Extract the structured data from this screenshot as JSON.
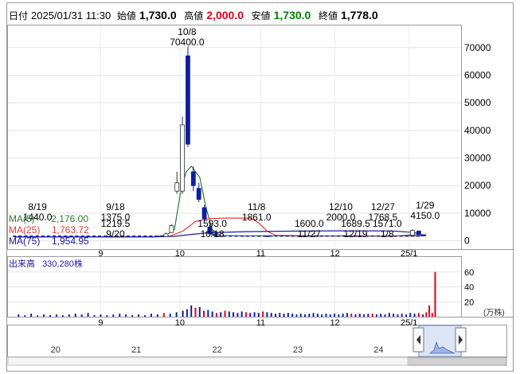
{
  "header": {
    "date_label": "日付",
    "date_value": "2025/01/31 11:30",
    "open_label": "始値",
    "open_value": "1,730.0",
    "high_label": "高値",
    "high_value": "2,000.0",
    "low_label": "安値",
    "low_value": "1,730.0",
    "close_label": "終値",
    "close_value": "1,778.0"
  },
  "colors": {
    "high": "#e0001b",
    "low": "#008000",
    "ma5": "#2e7d32",
    "ma25": "#e53935",
    "ma75": "#1a1aa6",
    "candle_up": "#ffffff",
    "candle_down": "#0d1f9e",
    "volume_up": "#e0001b",
    "volume_down": "#0d1f9e"
  },
  "legend": {
    "ma5": "MA(5)",
    "ma5_value": "2,176.00",
    "ma25": "MA(25)",
    "ma25_value": "1,763.72",
    "ma75": "MA(75)",
    "ma75_value": "1,954.95"
  },
  "volume_panel": {
    "title": "出来高",
    "value": "330,280株",
    "unit_label": "(万株)"
  },
  "chart_data": [
    {
      "type": "candlestick",
      "y_axis_side": "right",
      "ylim": [
        -3000,
        78000
      ],
      "y_ticks": [
        0,
        10000,
        20000,
        30000,
        40000,
        50000,
        60000,
        70000
      ],
      "x_ticks": [
        {
          "label": "9",
          "pos": 0.205
        },
        {
          "label": "10",
          "pos": 0.393
        },
        {
          "label": "11",
          "pos": 0.585
        },
        {
          "label": "12",
          "pos": 0.761
        },
        {
          "label": "25/1",
          "pos": 0.937
        }
      ],
      "annotations": [
        {
          "date": "8/19",
          "value": "1440.0",
          "kind": "high"
        },
        {
          "date": "9/18",
          "value": "1375.0",
          "kind": "high"
        },
        {
          "date": "9/20",
          "value": "1219.5",
          "kind": "low"
        },
        {
          "date": "10/8",
          "value": "70400.0",
          "kind": "high"
        },
        {
          "date": "10/18",
          "value": "1593.0",
          "kind": "low"
        },
        {
          "date": "11/8",
          "value": "1861.0",
          "kind": "high"
        },
        {
          "date": "11/27",
          "value": "1600.0",
          "kind": "low"
        },
        {
          "date": "12/10",
          "value": "2000.0",
          "kind": "high"
        },
        {
          "date": "12/19",
          "value": "1689.5",
          "kind": "low"
        },
        {
          "date": "12/27",
          "value": "1768.5",
          "kind": "high"
        },
        {
          "date": "1/8",
          "value": "1571.0",
          "kind": "low"
        },
        {
          "date": "1/29",
          "value": "4150.0",
          "kind": "high"
        }
      ],
      "candles": [
        {
          "pos": 0.36,
          "open": 1500,
          "close": 2500,
          "high": 3000,
          "low": 1400
        },
        {
          "pos": 0.373,
          "open": 3000,
          "close": 5500,
          "high": 6000,
          "low": 2800
        },
        {
          "pos": 0.386,
          "open": 18000,
          "close": 21000,
          "high": 25000,
          "low": 17000
        },
        {
          "pos": 0.399,
          "open": 18000,
          "close": 42000,
          "high": 45000,
          "low": 17000
        },
        {
          "pos": 0.412,
          "open": 67000,
          "close": 35000,
          "high": 70400,
          "low": 34000
        },
        {
          "pos": 0.425,
          "open": 25000,
          "close": 20000,
          "high": 27000,
          "low": 18000
        },
        {
          "pos": 0.438,
          "open": 19000,
          "close": 15000,
          "high": 21000,
          "low": 14000
        },
        {
          "pos": 0.451,
          "open": 12000,
          "close": 8000,
          "high": 13000,
          "low": 7000
        },
        {
          "pos": 0.464,
          "open": 5000,
          "close": 2500,
          "high": 6000,
          "low": 2000
        },
        {
          "pos": 0.477,
          "open": 2500,
          "close": 1800,
          "high": 3000,
          "low": 1593
        },
        {
          "pos": 0.6,
          "open": 1800,
          "close": 1700,
          "high": 1861,
          "low": 1650
        },
        {
          "pos": 0.785,
          "open": 1800,
          "close": 1900,
          "high": 2000,
          "low": 1700
        },
        {
          "pos": 0.945,
          "open": 2000,
          "close": 3800,
          "high": 4150,
          "low": 1900
        },
        {
          "pos": 0.96,
          "open": 3500,
          "close": 2200,
          "high": 3800,
          "low": 2000
        },
        {
          "pos": 0.972,
          "open": 2200,
          "close": 1778,
          "high": 2300,
          "low": 1730
        }
      ],
      "ma_series": [
        {
          "name": "MA(5)",
          "color_key": "ma5",
          "points": [
            [
              0.0,
              1400
            ],
            [
              0.33,
              1450
            ],
            [
              0.36,
              2000
            ],
            [
              0.38,
              4000
            ],
            [
              0.395,
              18000
            ],
            [
              0.408,
              25000
            ],
            [
              0.42,
              27000
            ],
            [
              0.44,
              23000
            ],
            [
              0.455,
              12000
            ],
            [
              0.47,
              4000
            ],
            [
              0.49,
              1900
            ],
            [
              0.55,
              1750
            ],
            [
              0.6,
              1780
            ],
            [
              0.7,
              1700
            ],
            [
              0.8,
              1750
            ],
            [
              0.9,
              1650
            ],
            [
              0.945,
              2200
            ],
            [
              0.97,
              2176
            ]
          ]
        },
        {
          "name": "MA(25)",
          "color_key": "ma25",
          "points": [
            [
              0.0,
              1450
            ],
            [
              0.33,
              1420
            ],
            [
              0.37,
              1700
            ],
            [
              0.4,
              3500
            ],
            [
              0.43,
              7000
            ],
            [
              0.46,
              8000
            ],
            [
              0.5,
              8200
            ],
            [
              0.56,
              8200
            ],
            [
              0.58,
              6500
            ],
            [
              0.6,
              3500
            ],
            [
              0.62,
              2000
            ],
            [
              0.7,
              1800
            ],
            [
              0.85,
              1760
            ],
            [
              0.97,
              1764
            ]
          ]
        },
        {
          "name": "MA(75)",
          "color_key": "ma75",
          "points": [
            [
              0.0,
              1400
            ],
            [
              0.33,
              1410
            ],
            [
              0.38,
              1600
            ],
            [
              0.42,
              2300
            ],
            [
              0.46,
              2900
            ],
            [
              0.55,
              3300
            ],
            [
              0.65,
              3500
            ],
            [
              0.75,
              3600
            ],
            [
              0.85,
              3600
            ],
            [
              0.9,
              3550
            ],
            [
              0.95,
              3000
            ],
            [
              0.97,
              1955
            ]
          ]
        }
      ]
    },
    {
      "type": "bar",
      "title": "出来高",
      "unit": "万株",
      "ylim": [
        0,
        80
      ],
      "y_ticks": [
        20,
        40,
        60
      ],
      "x_ticks": [
        {
          "label": "9",
          "pos": 0.205
        },
        {
          "label": "10",
          "pos": 0.393
        },
        {
          "label": "11",
          "pos": 0.585
        },
        {
          "label": "12",
          "pos": 0.761
        },
        {
          "label": "25/1",
          "pos": 0.937
        }
      ],
      "bars": [
        {
          "pos": 0.01,
          "v": 3,
          "up": false
        },
        {
          "pos": 0.025,
          "v": 2,
          "up": false
        },
        {
          "pos": 0.04,
          "v": 4,
          "up": false
        },
        {
          "pos": 0.055,
          "v": 2,
          "up": true
        },
        {
          "pos": 0.07,
          "v": 3,
          "up": false
        },
        {
          "pos": 0.085,
          "v": 2,
          "up": false
        },
        {
          "pos": 0.1,
          "v": 3,
          "up": false
        },
        {
          "pos": 0.115,
          "v": 2,
          "up": false
        },
        {
          "pos": 0.13,
          "v": 3,
          "up": false
        },
        {
          "pos": 0.145,
          "v": 4,
          "up": false
        },
        {
          "pos": 0.16,
          "v": 3,
          "up": false
        },
        {
          "pos": 0.175,
          "v": 5,
          "up": false
        },
        {
          "pos": 0.19,
          "v": 2,
          "up": false
        },
        {
          "pos": 0.205,
          "v": 3,
          "up": false
        },
        {
          "pos": 0.22,
          "v": 2,
          "up": false
        },
        {
          "pos": 0.235,
          "v": 3,
          "up": false
        },
        {
          "pos": 0.25,
          "v": 4,
          "up": false
        },
        {
          "pos": 0.265,
          "v": 3,
          "up": false
        },
        {
          "pos": 0.28,
          "v": 2,
          "up": false
        },
        {
          "pos": 0.295,
          "v": 3,
          "up": false
        },
        {
          "pos": 0.31,
          "v": 2,
          "up": false
        },
        {
          "pos": 0.325,
          "v": 4,
          "up": false
        },
        {
          "pos": 0.34,
          "v": 3,
          "up": false
        },
        {
          "pos": 0.355,
          "v": 5,
          "up": true
        },
        {
          "pos": 0.37,
          "v": 4,
          "up": false
        },
        {
          "pos": 0.385,
          "v": 6,
          "up": false
        },
        {
          "pos": 0.4,
          "v": 8,
          "up": false
        },
        {
          "pos": 0.41,
          "v": 10,
          "up": false
        },
        {
          "pos": 0.42,
          "v": 15,
          "up": false
        },
        {
          "pos": 0.43,
          "v": 12,
          "up": true
        },
        {
          "pos": 0.44,
          "v": 13,
          "up": false
        },
        {
          "pos": 0.45,
          "v": 8,
          "up": true
        },
        {
          "pos": 0.46,
          "v": 9,
          "up": false
        },
        {
          "pos": 0.47,
          "v": 7,
          "up": false
        },
        {
          "pos": 0.48,
          "v": 5,
          "up": true
        },
        {
          "pos": 0.49,
          "v": 6,
          "up": false
        },
        {
          "pos": 0.5,
          "v": 8,
          "up": true
        },
        {
          "pos": 0.51,
          "v": 7,
          "up": false
        },
        {
          "pos": 0.52,
          "v": 6,
          "up": false
        },
        {
          "pos": 0.53,
          "v": 5,
          "up": false
        },
        {
          "pos": 0.54,
          "v": 7,
          "up": false
        },
        {
          "pos": 0.55,
          "v": 6,
          "up": true
        },
        {
          "pos": 0.56,
          "v": 5,
          "up": false
        },
        {
          "pos": 0.57,
          "v": 6,
          "up": false
        },
        {
          "pos": 0.58,
          "v": 5,
          "up": false
        },
        {
          "pos": 0.59,
          "v": 7,
          "up": true
        },
        {
          "pos": 0.6,
          "v": 6,
          "up": false
        },
        {
          "pos": 0.61,
          "v": 5,
          "up": false
        },
        {
          "pos": 0.62,
          "v": 4,
          "up": false
        },
        {
          "pos": 0.63,
          "v": 5,
          "up": false
        },
        {
          "pos": 0.64,
          "v": 4,
          "up": false
        },
        {
          "pos": 0.65,
          "v": 5,
          "up": false
        },
        {
          "pos": 0.66,
          "v": 4,
          "up": false
        },
        {
          "pos": 0.67,
          "v": 3,
          "up": false
        },
        {
          "pos": 0.68,
          "v": 4,
          "up": false
        },
        {
          "pos": 0.69,
          "v": 3,
          "up": false
        },
        {
          "pos": 0.7,
          "v": 4,
          "up": false
        },
        {
          "pos": 0.71,
          "v": 5,
          "up": false
        },
        {
          "pos": 0.72,
          "v": 4,
          "up": false
        },
        {
          "pos": 0.73,
          "v": 3,
          "up": false
        },
        {
          "pos": 0.74,
          "v": 4,
          "up": false
        },
        {
          "pos": 0.75,
          "v": 3,
          "up": false
        },
        {
          "pos": 0.76,
          "v": 4,
          "up": false
        },
        {
          "pos": 0.77,
          "v": 3,
          "up": false
        },
        {
          "pos": 0.78,
          "v": 4,
          "up": false
        },
        {
          "pos": 0.79,
          "v": 5,
          "up": false
        },
        {
          "pos": 0.8,
          "v": 4,
          "up": true
        },
        {
          "pos": 0.81,
          "v": 3,
          "up": false
        },
        {
          "pos": 0.82,
          "v": 4,
          "up": false
        },
        {
          "pos": 0.83,
          "v": 3,
          "up": false
        },
        {
          "pos": 0.84,
          "v": 4,
          "up": false
        },
        {
          "pos": 0.85,
          "v": 4,
          "up": true
        },
        {
          "pos": 0.86,
          "v": 3,
          "up": false
        },
        {
          "pos": 0.87,
          "v": 4,
          "up": false
        },
        {
          "pos": 0.88,
          "v": 3,
          "up": false
        },
        {
          "pos": 0.89,
          "v": 5,
          "up": false
        },
        {
          "pos": 0.9,
          "v": 4,
          "up": false
        },
        {
          "pos": 0.91,
          "v": 3,
          "up": false
        },
        {
          "pos": 0.92,
          "v": 4,
          "up": false
        },
        {
          "pos": 0.93,
          "v": 3,
          "up": false
        },
        {
          "pos": 0.94,
          "v": 5,
          "up": false
        },
        {
          "pos": 0.95,
          "v": 4,
          "up": false
        },
        {
          "pos": 0.96,
          "v": 5,
          "up": true
        },
        {
          "pos": 0.97,
          "v": 3,
          "up": false
        },
        {
          "pos": 0.978,
          "v": 6,
          "up": true
        },
        {
          "pos": 0.985,
          "v": 15,
          "up": true
        },
        {
          "pos": 0.992,
          "v": 5,
          "up": true
        },
        {
          "pos": 0.999,
          "v": 60,
          "up": true
        }
      ]
    }
  ],
  "navigator": {
    "labels": [
      {
        "label": "20",
        "pos": 0.115
      },
      {
        "label": "21",
        "pos": 0.31
      },
      {
        "label": "22",
        "pos": 0.505
      },
      {
        "label": "23",
        "pos": 0.7
      },
      {
        "label": "24",
        "pos": 0.895
      }
    ]
  }
}
